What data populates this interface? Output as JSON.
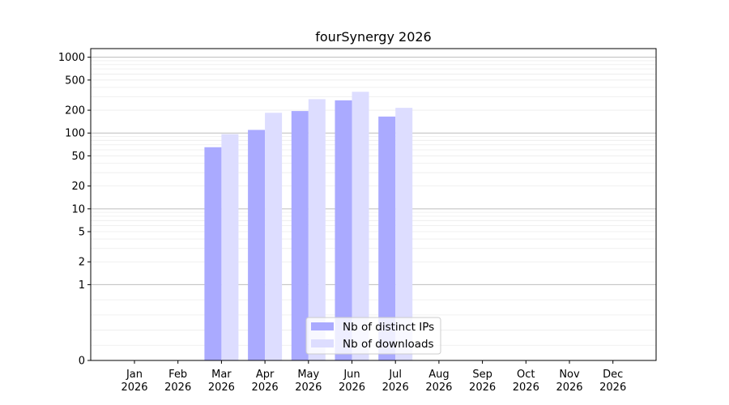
{
  "chart_data": {
    "type": "bar",
    "title": "fourSynergy 2026",
    "xlabel": "",
    "ylabel": "",
    "y_scale": "symlog",
    "ylim": [
      0,
      1300
    ],
    "y_ticks": [
      {
        "value": 0,
        "label": "0"
      },
      {
        "value": 1,
        "label": "1"
      },
      {
        "value": 2,
        "label": "2"
      },
      {
        "value": 5,
        "label": "5"
      },
      {
        "value": 10,
        "label": "10"
      },
      {
        "value": 20,
        "label": "20"
      },
      {
        "value": 50,
        "label": "50"
      },
      {
        "value": 100,
        "label": "100"
      },
      {
        "value": 200,
        "label": "200"
      },
      {
        "value": 500,
        "label": "500"
      },
      {
        "value": 1000,
        "label": "1000"
      }
    ],
    "categories": [
      {
        "month": "Jan",
        "year": "2026"
      },
      {
        "month": "Feb",
        "year": "2026"
      },
      {
        "month": "Mar",
        "year": "2026"
      },
      {
        "month": "Apr",
        "year": "2026"
      },
      {
        "month": "May",
        "year": "2026"
      },
      {
        "month": "Jun",
        "year": "2026"
      },
      {
        "month": "Jul",
        "year": "2026"
      },
      {
        "month": "Aug",
        "year": "2026"
      },
      {
        "month": "Sep",
        "year": "2026"
      },
      {
        "month": "Oct",
        "year": "2026"
      },
      {
        "month": "Nov",
        "year": "2026"
      },
      {
        "month": "Dec",
        "year": "2026"
      }
    ],
    "series": [
      {
        "name": "Nb of distinct IPs",
        "color": "#aaaaff",
        "values": [
          0,
          0,
          65,
          110,
          195,
          270,
          165,
          0,
          0,
          0,
          0,
          0
        ]
      },
      {
        "name": "Nb of downloads",
        "color": "#ddddff",
        "values": [
          0,
          0,
          97,
          185,
          280,
          350,
          215,
          0,
          0,
          0,
          0,
          0
        ]
      }
    ],
    "grid": true,
    "legend_position": "bottom-center"
  }
}
